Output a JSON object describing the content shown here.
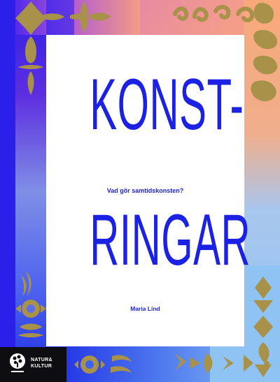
{
  "cover": {
    "title_line1": "KONST-",
    "title_line2": "RINGAR",
    "subtitle": "Vad gör samtidskonsten?",
    "author": "Maria Lind"
  },
  "publisher": {
    "name_line1": "NATUR&",
    "name_line2": "KULTUR",
    "logo_icon": "tree-logo-icon"
  },
  "colors": {
    "title_blue": "#1c22e4",
    "ornament_gold": "#a8924a",
    "frame_blue": "#1b2be0",
    "frame_orange": "#f3a27a",
    "frame_purple": "#7a3fd6",
    "frame_lightblue": "#7fbdf1",
    "panel_white": "#ffffff",
    "publisher_black": "#0e0e12"
  }
}
